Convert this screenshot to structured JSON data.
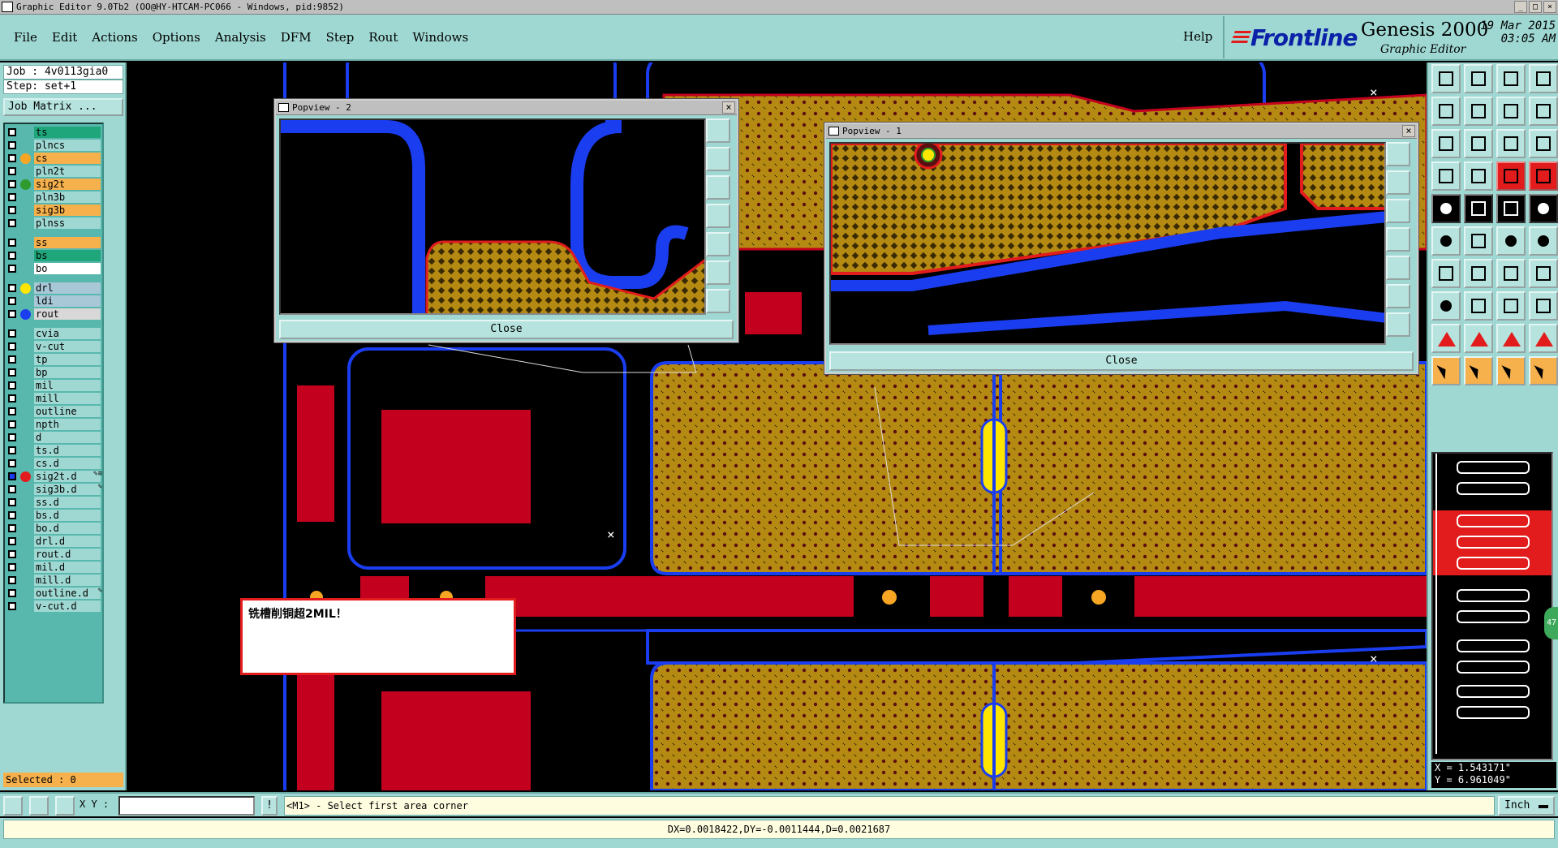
{
  "window": {
    "title": "Graphic Editor 9.0Tb2 (OO@HY-HTCAM-PC066 - Windows, pid:9852)",
    "controls": [
      "_",
      "□",
      "×"
    ]
  },
  "menu": {
    "items": [
      "File",
      "Edit",
      "Actions",
      "Options",
      "Analysis",
      "DFM",
      "Step",
      "Rout",
      "Windows"
    ],
    "help": "Help"
  },
  "brand": {
    "logo": "Frontline",
    "product": "Genesis 2000",
    "subtitle": "Graphic Editor",
    "date": "19 Mar 2015",
    "time": "03:05 AM"
  },
  "job": {
    "job_line": "Job : 4v0113gia0",
    "step_line": "Step: set+1",
    "matrix_button": "Job Matrix ..."
  },
  "layers": [
    {
      "name": "ts",
      "bg": "#1fa67a",
      "dot": ""
    },
    {
      "name": "plncs",
      "bg": "#9fd8d2",
      "dot": ""
    },
    {
      "name": "cs",
      "bg": "#f6b04c",
      "dot": "#f6a623"
    },
    {
      "name": "pln2t",
      "bg": "#9fd8d2",
      "dot": ""
    },
    {
      "name": "sig2t",
      "bg": "#f6b04c",
      "dot": "#2f9b2f"
    },
    {
      "name": "pln3b",
      "bg": "#9fd8d2",
      "dot": ""
    },
    {
      "name": "sig3b",
      "bg": "#f6b04c",
      "dot": ""
    },
    {
      "name": "plnss",
      "bg": "#9fd8d2",
      "dot": ""
    },
    {
      "sep": true
    },
    {
      "name": "ss",
      "bg": "#f6b04c",
      "dot": ""
    },
    {
      "name": "bs",
      "bg": "#1fa67a",
      "dot": ""
    },
    {
      "name": "bo",
      "bg": "#ffffff",
      "dot": ""
    },
    {
      "sep": true
    },
    {
      "name": "drl",
      "bg": "#a8c8d8",
      "dot": "#ffe600"
    },
    {
      "name": "ldi",
      "bg": "#a8c8d8",
      "dot": ""
    },
    {
      "name": "rout",
      "bg": "#d8d8d8",
      "dot": "#1a3df0"
    },
    {
      "sep": true
    },
    {
      "name": "cvia",
      "bg": "#9fd8d2",
      "dot": ""
    },
    {
      "name": "v-cut",
      "bg": "#9fd8d2",
      "dot": ""
    },
    {
      "name": "tp",
      "bg": "#9fd8d2",
      "dot": ""
    },
    {
      "name": "bp",
      "bg": "#9fd8d2",
      "dot": ""
    },
    {
      "name": "mil",
      "bg": "#9fd8d2",
      "dot": ""
    },
    {
      "name": "mill",
      "bg": "#9fd8d2",
      "dot": ""
    },
    {
      "name": "outline",
      "bg": "#9fd8d2",
      "dot": ""
    },
    {
      "name": "npth",
      "bg": "#9fd8d2",
      "dot": ""
    },
    {
      "name": "d",
      "bg": "#9fd8d2",
      "dot": ""
    },
    {
      "name": "ts.d",
      "bg": "#9fd8d2",
      "dot": ""
    },
    {
      "name": "cs.d",
      "bg": "#9fd8d2",
      "dot": ""
    },
    {
      "name": "sig2t.d",
      "bg": "#9fd8d2",
      "dot": "#e21c1c",
      "mark": "✎≡",
      "active": true
    },
    {
      "name": "sig3b.d",
      "bg": "#9fd8d2",
      "dot": "",
      "mark": "✎"
    },
    {
      "name": "ss.d",
      "bg": "#9fd8d2",
      "dot": ""
    },
    {
      "name": "bs.d",
      "bg": "#9fd8d2",
      "dot": ""
    },
    {
      "name": "bo.d",
      "bg": "#9fd8d2",
      "dot": ""
    },
    {
      "name": "drl.d",
      "bg": "#9fd8d2",
      "dot": ""
    },
    {
      "name": "rout.d",
      "bg": "#9fd8d2",
      "dot": ""
    },
    {
      "name": "mil.d",
      "bg": "#9fd8d2",
      "dot": ""
    },
    {
      "name": "mill.d",
      "bg": "#9fd8d2",
      "dot": ""
    },
    {
      "name": "outline.d",
      "bg": "#9fd8d2",
      "dot": "",
      "mark": "✎"
    },
    {
      "name": "v-cut.d",
      "bg": "#9fd8d2",
      "dot": ""
    }
  ],
  "selected_status": "Selected : 0",
  "popview2": {
    "title": "Popview - 2",
    "close_label": "Close"
  },
  "popview1": {
    "title": "Popview - 1",
    "close_label": "Close"
  },
  "message": "铣槽削铜超2MIL！",
  "coords": {
    "x": "X = 1.543171\"",
    "y": "Y = 6.961049\""
  },
  "round_button": "47",
  "command": {
    "xy_label": "X Y :",
    "xy_value": "",
    "info": "!",
    "prompt": "<M1> - Select first area corner",
    "units": "Inch"
  },
  "status": "DX=0.0018422,DY=-0.0011444,D=0.0021687",
  "colors": {
    "copper": "#b58a12",
    "rout": "#1a3df0",
    "mask": "#c4001f",
    "drill": "#ffe600",
    "panel_bg": "#9fd8d2"
  }
}
